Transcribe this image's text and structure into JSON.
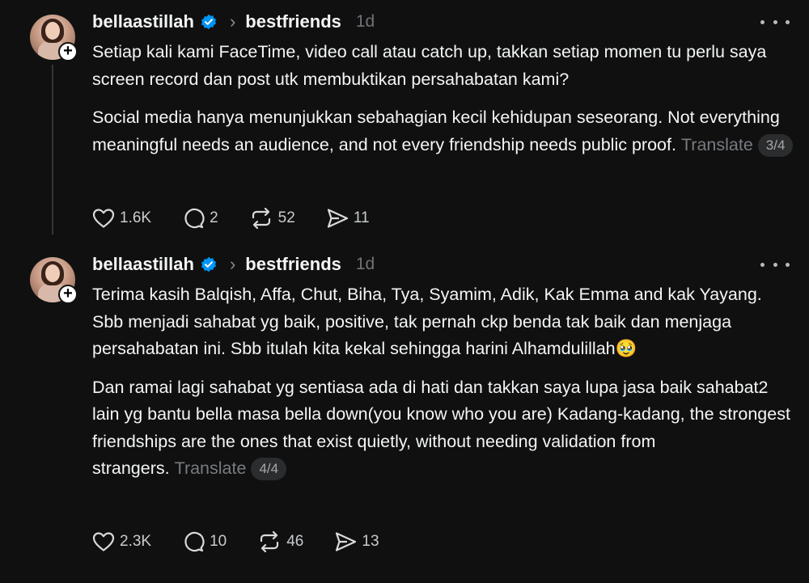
{
  "posts": [
    {
      "username": "bellaastillah",
      "community": "bestfriends",
      "time": "1d",
      "paragraphs": [
        "Setiap kali kami FaceTime, video call atau catch up, takkan setiap momen tu perlu saya screen record dan post utk membuktikan persahabatan kami?",
        "Social media hanya menunjukkan sebahagian kecil kehidupan seseorang. Not everything meaningful needs an audience, and not every friendship needs public proof."
      ],
      "translate_label": "Translate",
      "pager": "3/4",
      "likes": "1.6K",
      "replies": "2",
      "reposts": "52",
      "shares": "11"
    },
    {
      "username": "bellaastillah",
      "community": "bestfriends",
      "time": "1d",
      "paragraphs": [
        "Terima kasih Balqish, Affa, Chut, Biha, Tya, Syamim, Adik, Kak Emma and kak Yayang.\nSbb menjadi sahabat yg baik, positive, tak pernah ckp benda tak baik dan menjaga persahabatan ini. Sbb itulah kita kekal sehingga harini Alhamdulillah🥹",
        "Dan ramai lagi sahabat yg sentiasa ada di hati dan takkan saya lupa jasa baik sahabat2 lain yg bantu bella masa bella down(you know who you are) Kadang-kadang, the strongest friendships are the ones that exist quietly, without needing validation from strangers."
      ],
      "translate_label": "Translate",
      "pager": "4/4",
      "likes": "2.3K",
      "replies": "10",
      "reposts": "46",
      "shares": "13"
    }
  ],
  "colors": {
    "background": "#101010",
    "text": "#f3f5f7",
    "muted": "#777b80",
    "verified": "#0095f6"
  }
}
